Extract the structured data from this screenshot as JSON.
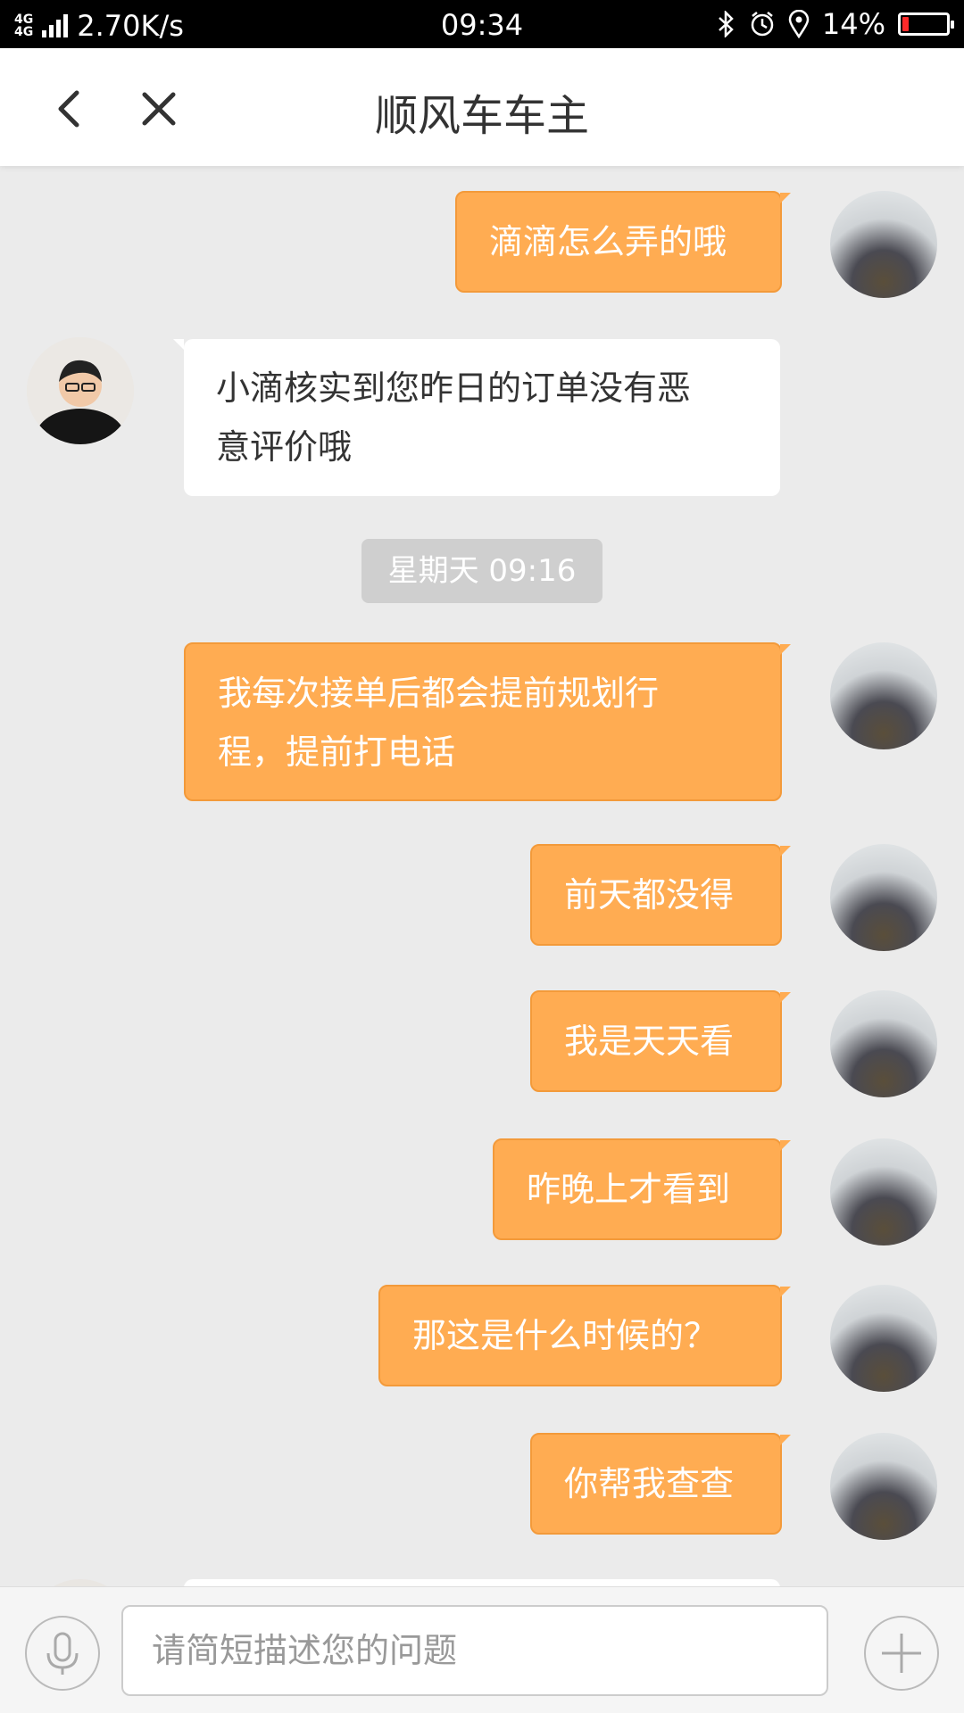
{
  "status_bar": {
    "network_badge_top": "4G",
    "network_badge_bottom": "4G",
    "speed": "2.70K/s",
    "time": "09:34",
    "battery": "14%",
    "battery_level": 0.14,
    "icons": [
      "signal-icon",
      "bluetooth-icon",
      "alarm-icon",
      "location-icon",
      "battery-icon"
    ]
  },
  "header": {
    "title": "顺风车车主",
    "icons": [
      "back-icon",
      "close-icon"
    ]
  },
  "chat": {
    "messages": [
      {
        "sender": "owner",
        "lines": [
          "滴滴怎么弄的哦"
        ]
      },
      {
        "sender": "support",
        "lines": [
          "小滴核实到您昨日的订单没有恶",
          "意评价哦"
        ]
      },
      {
        "sender": "owner",
        "lines": [
          "我每次接单后都会提前规划行",
          "程，提前打电话"
        ]
      },
      {
        "sender": "owner",
        "lines": [
          "前天都没得"
        ]
      },
      {
        "sender": "owner",
        "lines": [
          "我是天天看"
        ]
      },
      {
        "sender": "owner",
        "lines": [
          "昨晚上才看到"
        ]
      },
      {
        "sender": "owner",
        "lines": [
          "那这是什么时候的？"
        ]
      },
      {
        "sender": "owner",
        "lines": [
          "你帮我查查"
        ]
      }
    ],
    "timestamp": "星期天 09:16"
  },
  "input_bar": {
    "placeholder": "请简短描述您的问题",
    "icons": [
      "microphone-icon",
      "plus-icon"
    ]
  },
  "colors": {
    "outgoing_bubble": "#ffac52",
    "incoming_bubble": "#ffffff",
    "background": "#ebebeb",
    "battery_low": "#ff2a2a"
  }
}
